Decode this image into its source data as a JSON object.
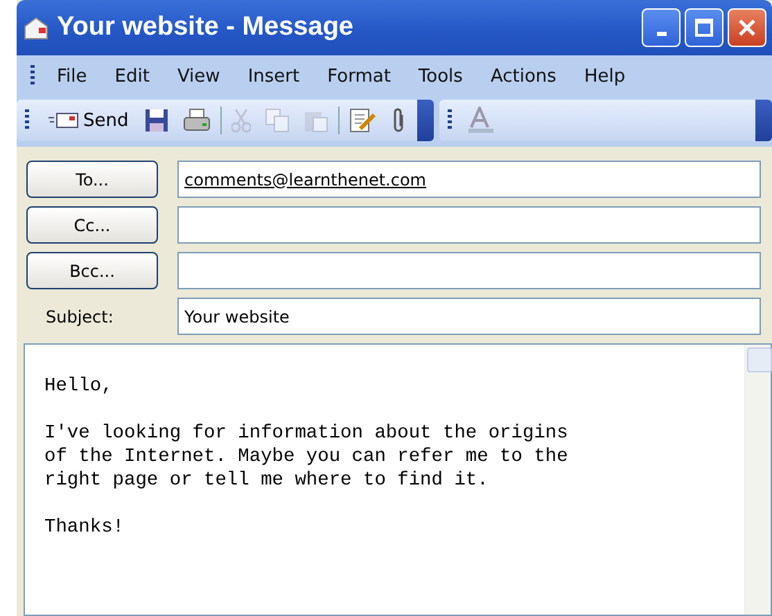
{
  "window": {
    "title": "Your website - Message"
  },
  "menu": [
    "File",
    "Edit",
    "View",
    "Insert",
    "Format",
    "Tools",
    "Actions",
    "Help"
  ],
  "toolbar": {
    "send": "Send",
    "tools": [
      {
        "kind": "save",
        "disabled": false
      },
      {
        "kind": "print",
        "disabled": false
      },
      {
        "kind": "cut",
        "disabled": true
      },
      {
        "kind": "copy",
        "disabled": true
      },
      {
        "kind": "paste",
        "disabled": true
      },
      {
        "kind": "sign",
        "disabled": false
      },
      {
        "kind": "attach",
        "disabled": false
      }
    ]
  },
  "fields": [
    {
      "kind": "button",
      "label": "To...",
      "value": "comments@learnthenet.com"
    },
    {
      "kind": "button",
      "label": "Cc..."
    },
    {
      "kind": "button",
      "label": "Bcc..."
    },
    {
      "kind": "label",
      "label": "Subject:",
      "value": "Your website"
    }
  ],
  "body": [
    [
      "Hello,"
    ],
    [
      "I've looking for information about the origins",
      "of the Internet. Maybe you can refer me to the",
      "right page or tell me where to find it."
    ],
    [
      "Thanks!"
    ]
  ]
}
